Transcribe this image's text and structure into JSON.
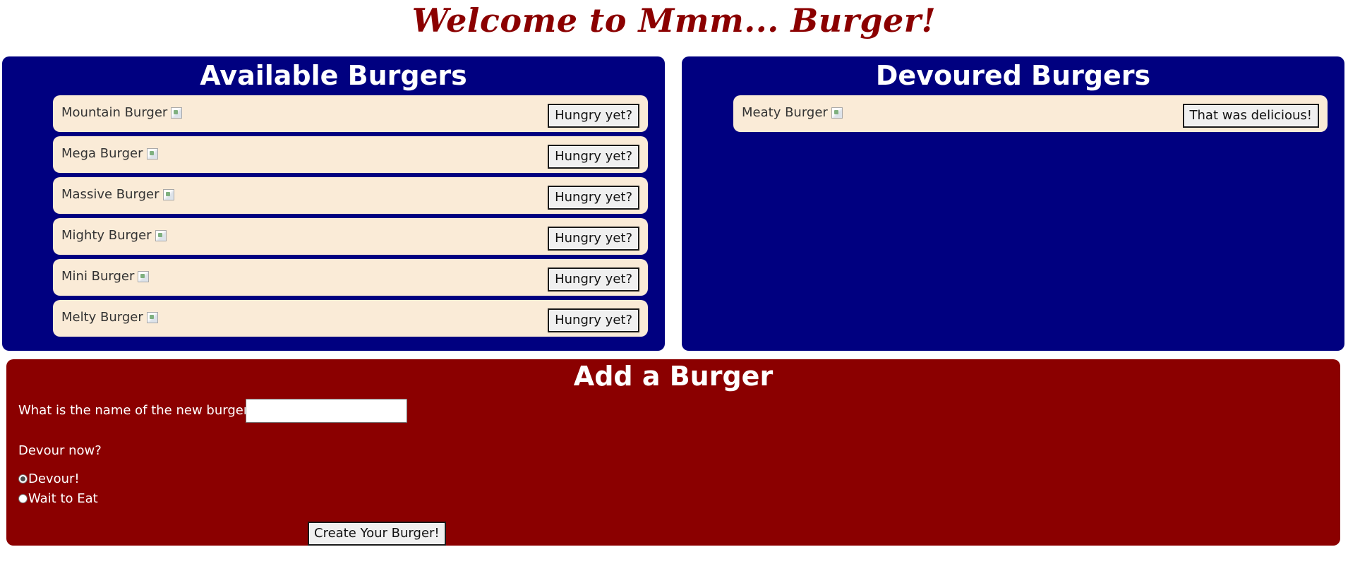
{
  "header": {
    "title": "Welcome to Mmm... Burger!"
  },
  "available": {
    "title": "Available Burgers",
    "button_label": "Hungry yet?",
    "items": [
      {
        "name": "Mountain Burger"
      },
      {
        "name": "Mega Burger"
      },
      {
        "name": "Massive Burger"
      },
      {
        "name": "Mighty Burger"
      },
      {
        "name": "Mini Burger"
      },
      {
        "name": "Melty Burger"
      }
    ]
  },
  "devoured": {
    "title": "Devoured Burgers",
    "button_label": "That was delicious!",
    "items": [
      {
        "name": "Meaty Burger"
      }
    ]
  },
  "add_form": {
    "title": "Add a Burger",
    "name_question": "What is the name of the new burger?",
    "name_value": "",
    "devour_question": "Devour now?",
    "options": [
      {
        "label": "Devour!",
        "checked": true
      },
      {
        "label": "Wait to Eat",
        "checked": false
      }
    ],
    "submit_label": "Create Your Burger!"
  },
  "colors": {
    "title": "#8b0000",
    "panel_blue": "#000080",
    "panel_red": "#8b0000",
    "item_bg": "#faebd7"
  }
}
